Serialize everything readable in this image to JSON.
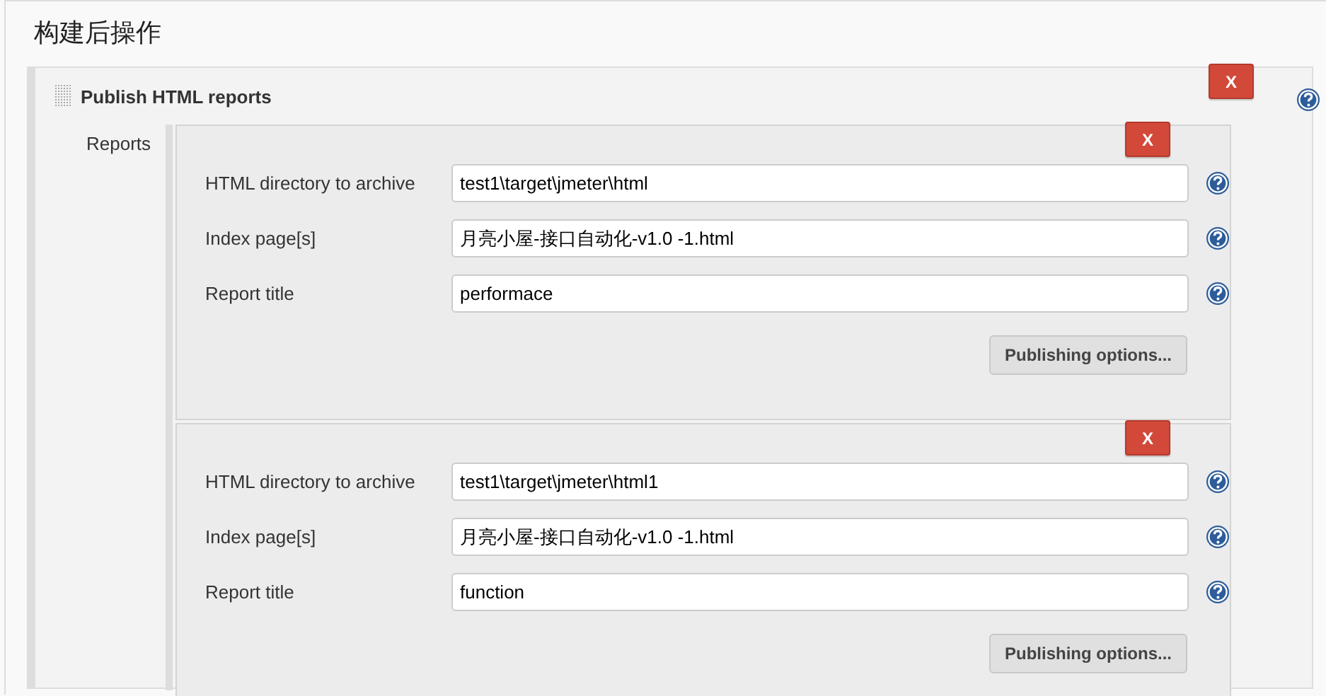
{
  "section_title": "构建后操作",
  "step": {
    "title": "Publish HTML reports",
    "delete_label": "X",
    "reports_label": "Reports",
    "reports": [
      {
        "delete_label": "X",
        "fields": [
          {
            "label": "HTML directory to archive",
            "value": "test1\\target\\jmeter\\html"
          },
          {
            "label": "Index page[s]",
            "value": "月亮小屋-接口自动化-v1.0 -1.html"
          },
          {
            "label": "Report title",
            "value": "performace"
          }
        ],
        "options_button": "Publishing options..."
      },
      {
        "delete_label": "X",
        "fields": [
          {
            "label": "HTML directory to archive",
            "value": "test1\\target\\jmeter\\html1"
          },
          {
            "label": "Index page[s]",
            "value": "月亮小屋-接口自动化-v1.0 -1.html"
          },
          {
            "label": "Report title",
            "value": "function"
          }
        ],
        "options_button": "Publishing options..."
      }
    ]
  }
}
